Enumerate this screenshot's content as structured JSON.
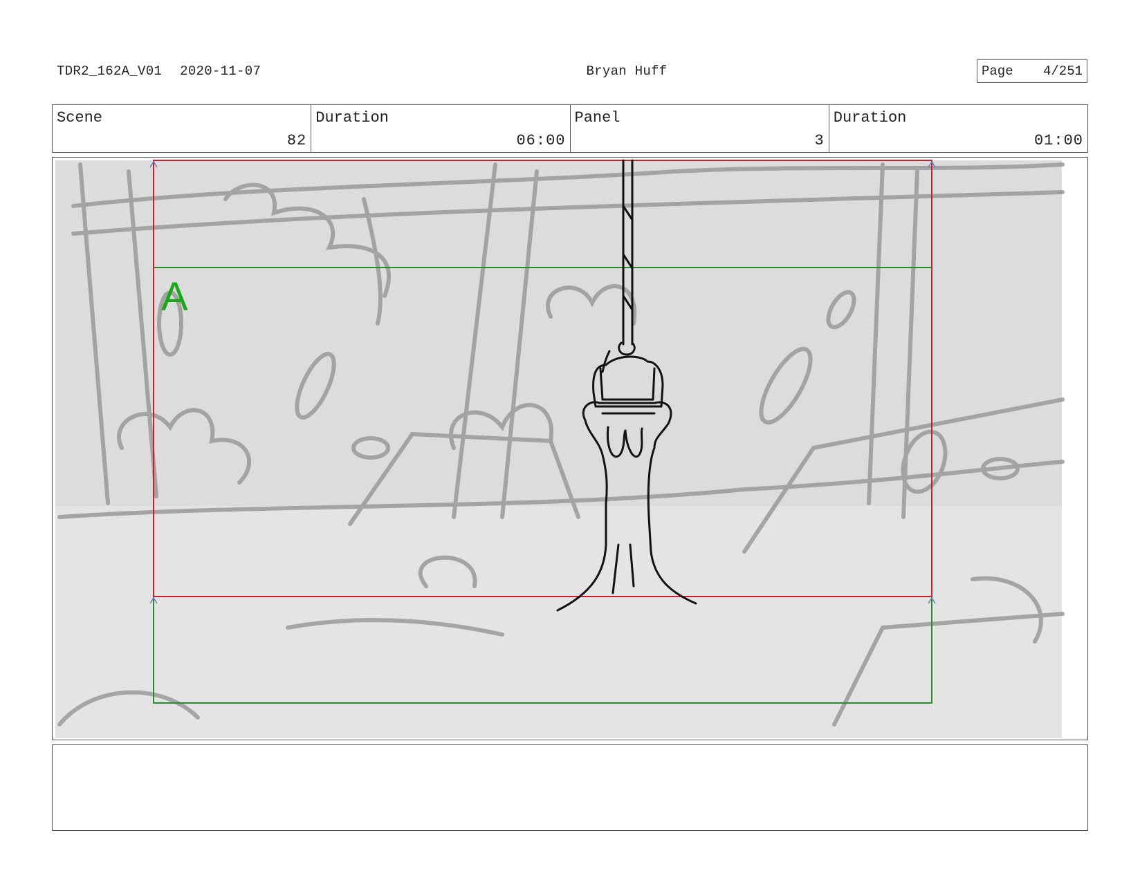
{
  "header": {
    "file_name": "TDR2_162A_V01",
    "date": "2020-11-07",
    "artist": "Bryan Huff",
    "page_label": "Page",
    "page_value": "4/251"
  },
  "info": {
    "scene_label": "Scene",
    "scene_value": "82",
    "scene_duration_label": "Duration",
    "scene_duration_value": "06:00",
    "panel_label": "Panel",
    "panel_value": "3",
    "panel_duration_label": "Duration",
    "panel_duration_value": "01:00"
  },
  "panel": {
    "field_marker": "A",
    "colors": {
      "camera_frame": "#c8202a",
      "field_frame": "#2a8a2a",
      "field_label": "#1aa81a",
      "sketch": "#8a8a8a",
      "line_art": "#111111"
    }
  },
  "notes": {
    "text": ""
  }
}
